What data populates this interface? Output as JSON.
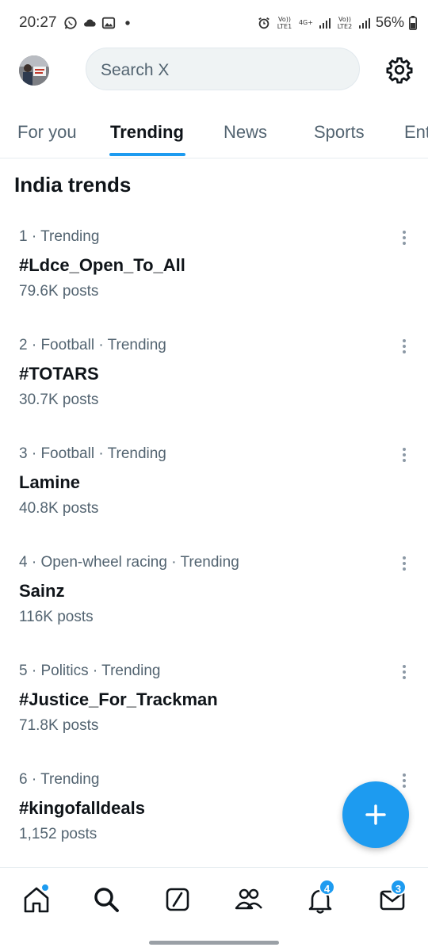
{
  "status_bar": {
    "time": "20:27",
    "lte1": "Vo)) LTE1",
    "net": "4G+",
    "lte2": "Vo)) LTE2",
    "battery": "56%"
  },
  "header": {
    "search_placeholder": "Search X"
  },
  "tabs": [
    {
      "label": "For you"
    },
    {
      "label": "Trending"
    },
    {
      "label": "News"
    },
    {
      "label": "Sports"
    },
    {
      "label": "Ent"
    }
  ],
  "section_title": "India trends",
  "trends": [
    {
      "meta": "1 · Trending",
      "name": "#Ldce_Open_To_All",
      "posts": "79.6K posts"
    },
    {
      "meta": "2 · Football · Trending",
      "name": "#TOTARS",
      "posts": "30.7K posts"
    },
    {
      "meta": "3 · Football · Trending",
      "name": "Lamine",
      "posts": "40.8K posts"
    },
    {
      "meta": "4 · Open-wheel racing · Trending",
      "name": "Sainz",
      "posts": "116K posts"
    },
    {
      "meta": "5 · Politics · Trending",
      "name": "#Justice_For_Trackman",
      "posts": "71.8K posts"
    },
    {
      "meta": "6 · Trending",
      "name": "#kingofalldeals",
      "posts": "1,152 posts"
    }
  ],
  "bottom_nav": {
    "notifications_badge": "4",
    "messages_badge": "3"
  },
  "colors": {
    "accent": "#1d9bf0",
    "text_primary": "#0f1419",
    "text_secondary": "#536471"
  },
  "icons": [
    "whatsapp-icon",
    "cloud-icon",
    "gallery-icon",
    "alarm-icon",
    "signal-icon",
    "battery-icon",
    "gear-icon",
    "more-vertical-icon",
    "plus-icon",
    "home-icon",
    "search-icon",
    "grok-icon",
    "communities-icon",
    "bell-icon",
    "mail-icon"
  ]
}
